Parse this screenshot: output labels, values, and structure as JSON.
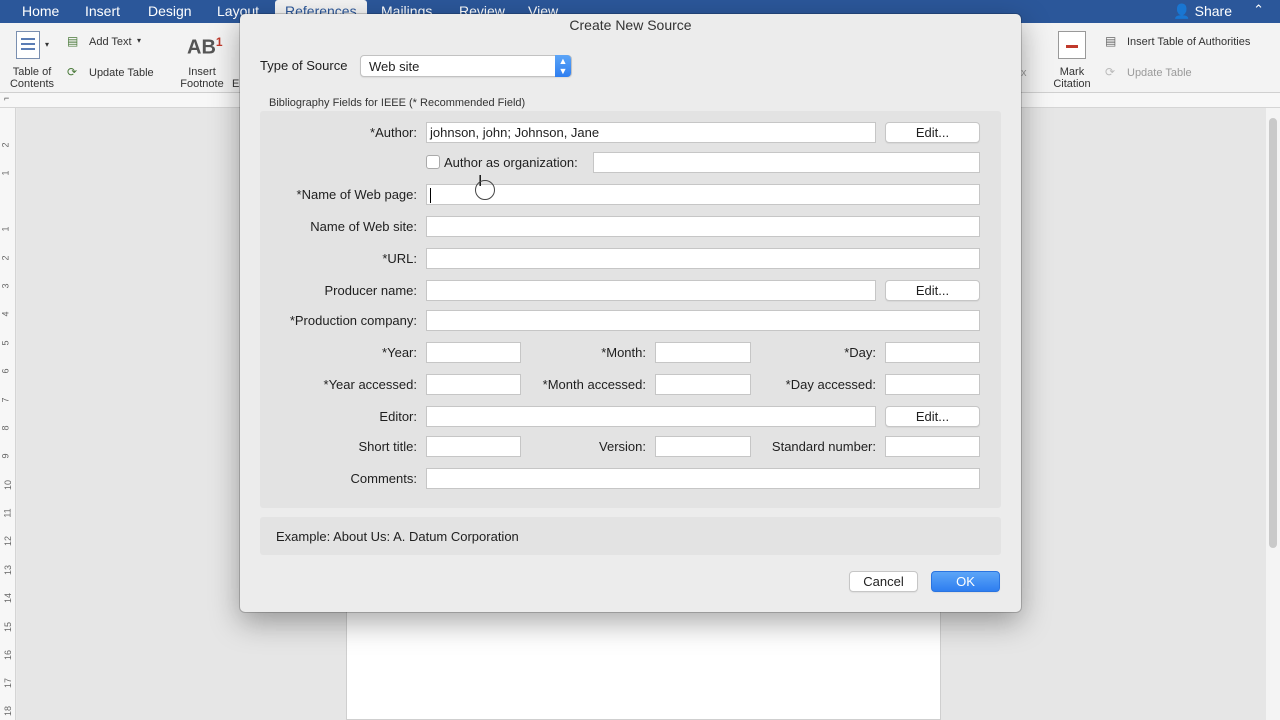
{
  "word": {
    "tabs": [
      "Home",
      "Insert",
      "Design",
      "Layout",
      "References",
      "Mailings",
      "Review",
      "View"
    ],
    "active_tab": "References",
    "share_label": "Share",
    "ribbon": {
      "toc_label": "Table of\nContents",
      "add_text": "Add Text",
      "update_table_left": "Update Table",
      "insert_footnote": "Insert\nFootnote",
      "cut_label": "E",
      "mark_citation": "Mark\nCitation",
      "insert_toa": "Insert Table of Authorities",
      "update_table_right": "Update Table",
      "partial_x": "x"
    },
    "vruler_ticks": [
      "2",
      "1",
      "1",
      "2",
      "3",
      "4",
      "5",
      "6",
      "7",
      "8",
      "9",
      "10",
      "11",
      "12",
      "13",
      "14",
      "15",
      "16",
      "17",
      "18"
    ]
  },
  "dialog": {
    "title": "Create New Source",
    "type_of_source_label": "Type of Source",
    "type_of_source_value": "Web site",
    "section_caption": "Bibliography Fields for IEEE  (* Recommended Field)",
    "fields": {
      "author_label": "Author:",
      "author_value": "johnson, john; Johnson, Jane",
      "author_org_label": "Author as organization:",
      "web_page_label": "Name of Web page:",
      "web_site_label": "Name of Web site:",
      "url_label": "URL:",
      "producer_label": "Producer name:",
      "production_company_label": "Production company:",
      "year_label": "Year:",
      "month_label": "Month:",
      "day_label": "Day:",
      "year_accessed_label": "Year accessed:",
      "month_accessed_label": "Month accessed:",
      "day_accessed_label": "Day accessed:",
      "editor_label": "Editor:",
      "short_title_label": "Short title:",
      "version_label": "Version:",
      "standard_number_label": "Standard number:",
      "comments_label": "Comments:"
    },
    "edit_button": "Edit...",
    "example_text": "Example: About Us: A. Datum Corporation",
    "cancel_button": "Cancel",
    "ok_button": "OK"
  },
  "colors": {
    "word_blue": "#2b579a",
    "mac_blue": "#2e7ef0"
  }
}
